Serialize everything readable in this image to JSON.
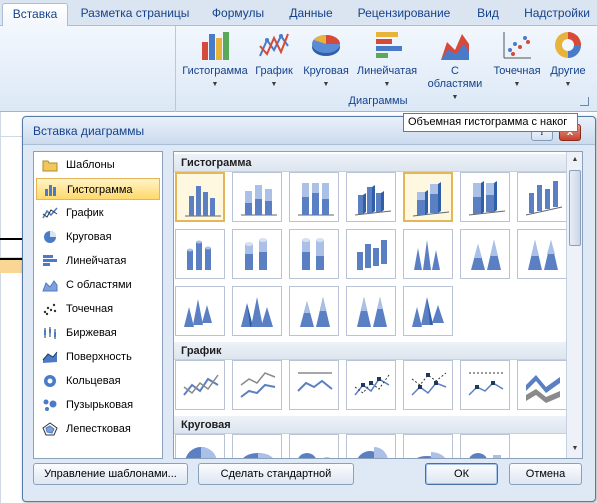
{
  "ribbon": {
    "tabs": [
      {
        "label": "Вставка",
        "active": true
      },
      {
        "label": "Разметка страницы",
        "active": false
      },
      {
        "label": "Формулы",
        "active": false
      },
      {
        "label": "Данные",
        "active": false
      },
      {
        "label": "Рецензирование",
        "active": false
      },
      {
        "label": "Вид",
        "active": false
      },
      {
        "label": "Надстройки",
        "active": false
      }
    ],
    "buttons": [
      {
        "label": "Гистограмма",
        "icon": "column-chart-icon"
      },
      {
        "label": "График",
        "icon": "line-chart-icon"
      },
      {
        "label": "Круговая",
        "icon": "pie-chart-icon"
      },
      {
        "label": "Линейчатая",
        "icon": "bar-chart-icon"
      },
      {
        "label": "С областями",
        "icon": "area-chart-icon"
      },
      {
        "label": "Точечная",
        "icon": "scatter-chart-icon"
      },
      {
        "label": "Другие",
        "icon": "other-chart-icon"
      }
    ],
    "group_label": "Диаграммы"
  },
  "dialog": {
    "title": "Вставка диаграммы",
    "help_label": "?",
    "close_label": "x",
    "categories": [
      {
        "label": "Шаблоны",
        "icon": "folder-icon",
        "selected": false
      },
      {
        "label": "Гистограмма",
        "icon": "column-chart-icon",
        "selected": true
      },
      {
        "label": "График",
        "icon": "line-chart-icon",
        "selected": false
      },
      {
        "label": "Круговая",
        "icon": "pie-chart-icon",
        "selected": false
      },
      {
        "label": "Линейчатая",
        "icon": "bar-chart-icon",
        "selected": false
      },
      {
        "label": "С областями",
        "icon": "area-chart-icon",
        "selected": false
      },
      {
        "label": "Точечная",
        "icon": "scatter-chart-icon",
        "selected": false
      },
      {
        "label": "Биржевая",
        "icon": "stock-chart-icon",
        "selected": false
      },
      {
        "label": "Поверхность",
        "icon": "surface-chart-icon",
        "selected": false
      },
      {
        "label": "Кольцевая",
        "icon": "doughnut-chart-icon",
        "selected": false
      },
      {
        "label": "Пузырьковая",
        "icon": "bubble-chart-icon",
        "selected": false
      },
      {
        "label": "Лепестковая",
        "icon": "radar-chart-icon",
        "selected": false
      }
    ],
    "sections": {
      "column": "Гистограмма",
      "line": "График",
      "pie": "Круговая"
    },
    "tooltip": "Объемная гистограмма с наког",
    "buttons": {
      "manage_templates": "Управление шаблонами...",
      "set_default": "Сделать стандартной",
      "ok": "ОК",
      "cancel": "Отмена"
    },
    "colors": {
      "selection": "#ffd96b",
      "accent": "#15428b",
      "chart_blue": "#5b7fc3"
    }
  }
}
